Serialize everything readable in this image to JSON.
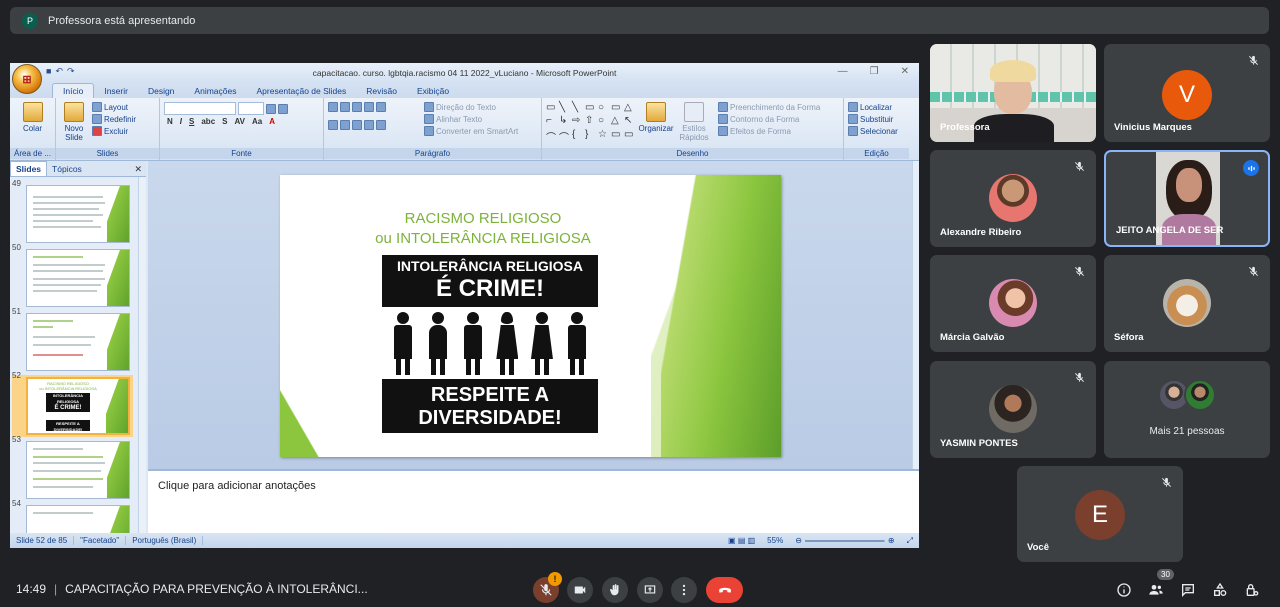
{
  "topbar": {
    "avatar_letter": "P",
    "text": "Professora está apresentando"
  },
  "ppt": {
    "window_title": "capacitacao. curso. lgbtqia.racismo 04 11 2022_vLuciano - Microsoft PowerPoint",
    "tabs": [
      "Início",
      "Inserir",
      "Design",
      "Animações",
      "Apresentação de Slides",
      "Revisão",
      "Exibição"
    ],
    "ribbon": {
      "clipboard": {
        "paste": "Colar",
        "cut": "",
        "label": "Área de ..."
      },
      "slides": {
        "new_slide": "Novo Slide",
        "layout": "Layout",
        "reset": "Redefinir",
        "delete": "Excluir",
        "label": "Slides"
      },
      "font": {
        "label": "Fonte"
      },
      "paragraph": {
        "text_dir": "Direção do Texto",
        "align_text": "Alinhar Texto",
        "smartart": "Converter em SmartArt",
        "label": "Parágrafo"
      },
      "drawing": {
        "arrange": "Organizar",
        "quick_styles": "Estilos Rápidos",
        "fill": "Preenchimento da Forma",
        "outline": "Contorno da Forma",
        "effects": "Efeitos de Forma",
        "label": "Desenho"
      },
      "editing": {
        "find": "Localizar",
        "replace": "Substituir",
        "select": "Selecionar",
        "label": "Edição"
      }
    },
    "pane_tabs": [
      "Slides",
      "Tópicos"
    ],
    "thumb_numbers": [
      "49",
      "50",
      "51",
      "52",
      "53",
      "54"
    ],
    "thumb_52": {
      "line1": "RACISMO RELIGIOSO",
      "line2": "ou INTOLERÂNCIA RELIGIOSA",
      "line3": "INTOLERÂNCIA RELIGIOSA",
      "line4": "É CRIME!",
      "line5": "RESPEITE A",
      "line6": "DIVERSIDADE!"
    },
    "slide": {
      "title1": "RACISMO RELIGIOSO",
      "title2": "ou INTOLERÂNCIA RELIGIOSA",
      "sign_top": "INTOLERÂNCIA RELIGIOSA",
      "sign_crime": "É CRIME!",
      "sign_b1": "RESPEITE A",
      "sign_b2": "DIVERSIDADE!"
    },
    "notes_placeholder": "Clique para adicionar anotações",
    "status": {
      "slide": "Slide 52 de 85",
      "theme": "\"Facetado\"",
      "language": "Português (Brasil)",
      "zoom": "55%"
    }
  },
  "participants": [
    {
      "name": "Professora",
      "type": "video",
      "muted": false
    },
    {
      "name": "Vinicius Marques",
      "letter": "V",
      "color": "#e8590c",
      "muted": true
    },
    {
      "name": "Alexandre Ribeiro",
      "muted": true
    },
    {
      "name": "JEITO ANGELA DE SER",
      "muted": false,
      "speaking": true
    },
    {
      "name": "Márcia Galvão",
      "muted": true
    },
    {
      "name": "Séfora",
      "muted": true
    },
    {
      "name": "YASMIN PONTES",
      "muted": true
    },
    {
      "name": "Mais 21 pessoas"
    },
    {
      "name": "Você",
      "letter": "E",
      "color": "#7b3f2e",
      "muted": true
    }
  ],
  "bottom": {
    "time": "14:49",
    "separator": "|",
    "meeting": "CAPACITAÇÃO PARA PREVENÇÃO À INTOLERÂNCI...",
    "people_count": "30",
    "mic_alert": "!"
  },
  "colors": {
    "bg": "#202124",
    "tile": "#3c4043",
    "end_call": "#ea4335",
    "accent": "#8ab4f8",
    "slide_green": "#7cb33a"
  }
}
